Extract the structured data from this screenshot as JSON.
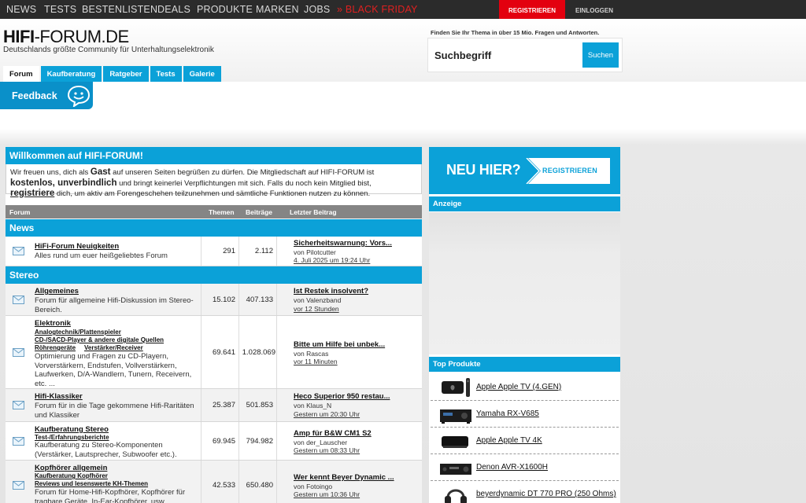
{
  "topnav": {
    "items": [
      "NEWS",
      "TESTS",
      "BESTENLISTEN",
      "DEALS",
      "PRODUKTE",
      "MARKEN",
      "JOBS"
    ],
    "black_friday": "» BLACK FRIDAY",
    "register": "REGISTRIEREN",
    "login": "EINLOGGEN"
  },
  "header": {
    "logo_bold": "HIFI",
    "logo_rest": "-FORUM.DE",
    "tagline": "Deutschlands größte Community für Unterhaltungselektronik",
    "search_label": "Finden Sie Ihr Thema in über 15 Mio. Fragen und Antworten.",
    "search_placeholder": "Suchbegriff",
    "search_button": "Suchen",
    "tabs": [
      "Forum",
      "Kaufberatung",
      "Ratgeber",
      "Tests",
      "Galerie"
    ]
  },
  "feedback": {
    "label": "Feedback"
  },
  "welcome": {
    "title": "Willkommen auf HIFI-FORUM!",
    "t1": "Wir freuen uns, dich als ",
    "gast": "Gast",
    "t2": " auf unseren Seiten begrüßen zu dürfen. Die Mitgliedschaft auf HIFI-FORUM ist ",
    "kostenlos": "kostenlos, unverbindlich",
    "t3": " und bringt keinerlei Verpflichtungen mit sich. Falls du noch kein Mitglied bist, ",
    "registriere": "registriere",
    "t4": " dich, um aktiv am Forengeschehen teilzunehmen und sämtliche Funktionen nutzen zu können."
  },
  "table": {
    "headers": {
      "forum": "Forum",
      "themen": "Themen",
      "beitraege": "Beiträge",
      "letzter": "Letzter Beitrag"
    },
    "sections": [
      "News",
      "Stereo"
    ],
    "rows": [
      {
        "title": "HiFi-Forum Neuigkeiten",
        "subs": [],
        "desc": "Alles rund um euer heißgeliebtes Forum",
        "themen": "291",
        "beitraege": "2.112",
        "lp_title": "Sicherheitswarnung: Vors...",
        "lp_by": "von Pilotcutter",
        "lp_date": "4. Juli 2025 um 19:24 Uhr"
      },
      {
        "title": "Allgemeines",
        "subs": [],
        "desc": "Forum für allgemeine Hifi-Diskussion im Stereo-Bereich.",
        "themen": "15.102",
        "beitraege": "407.133",
        "lp_title": "Ist Restek insolvent?",
        "lp_by": "von Valenzband",
        "lp_date": "vor 12 Stunden"
      },
      {
        "title": "Elektronik",
        "subs": [
          "Analogtechnik/Plattenspieler",
          "CD-/SACD-Player & andere digitale Quellen",
          "Röhrengeräte",
          "Verstärker/Receiver"
        ],
        "desc": "Optimierung und Fragen zu CD-Playern, Vorverstärkern, Endstufen, Vollverstärkern, Laufwerken, D/A-Wandlern, Tunern, Receivern, etc. ...",
        "themen": "69.641",
        "beitraege": "1.028.069",
        "lp_title": "Bitte um Hilfe bei unbek...",
        "lp_by": "von Rascas",
        "lp_date": "vor 11 Minuten"
      },
      {
        "title": "Hifi-Klassiker",
        "subs": [],
        "desc": "Forum für in die Tage gekommene Hifi-Raritäten und Klassiker",
        "themen": "25.387",
        "beitraege": "501.853",
        "lp_title": "Heco Superior 950 restau...",
        "lp_by": "von Klaus_N",
        "lp_date": "Gestern um 20:30 Uhr"
      },
      {
        "title": "Kaufberatung Stereo",
        "subs": [
          "Test-/Erfahrungsberichte"
        ],
        "desc": "Kaufberatung zu Stereo-Komponenten (Verstärker, Lautsprecher, Subwoofer etc.).",
        "themen": "69.945",
        "beitraege": "794.982",
        "lp_title": "Amp für B&W CM1 S2",
        "lp_by": "von der_Lauscher",
        "lp_date": "Gestern um 08:33 Uhr"
      },
      {
        "title": "Kopfhörer allgemein",
        "subs": [
          "Kaufberatung Kopfhörer",
          "Reviews und lesenswerte KH-Themen"
        ],
        "desc": "Forum für Home-Hifi-Kopfhörer, Kopfhörer für tragbare Geräte, In-Ear-Kopfhörer, usw.",
        "themen": "42.533",
        "beitraege": "650.480",
        "lp_title": "Wer kennt Beyer Dynamic ...",
        "lp_by": "von Fotoingo",
        "lp_date": "Gestern um 10:36 Uhr"
      }
    ]
  },
  "sidebar": {
    "neu_hier": "NEU HIER?",
    "register": "REGISTRIEREN",
    "anzeige": "Anzeige",
    "top_produkte": "Top Produkte",
    "products": [
      {
        "name": "Apple Apple TV (4.GEN)",
        "icon": "apple-tv-icon"
      },
      {
        "name": "Yamaha RX-V685",
        "icon": "receiver-icon"
      },
      {
        "name": "Apple Apple TV 4K",
        "icon": "apple-tv-4k-icon"
      },
      {
        "name": "Denon AVR-X1600H",
        "icon": "receiver-icon"
      },
      {
        "name": "beyerdynamic DT 770 PRO (250 Ohms)",
        "icon": "headphones-icon"
      }
    ]
  },
  "colors": {
    "accent": "#0ba1d8",
    "topbar": "#2b2b2b",
    "register": "#e3000f",
    "black_friday": "#e02020"
  }
}
